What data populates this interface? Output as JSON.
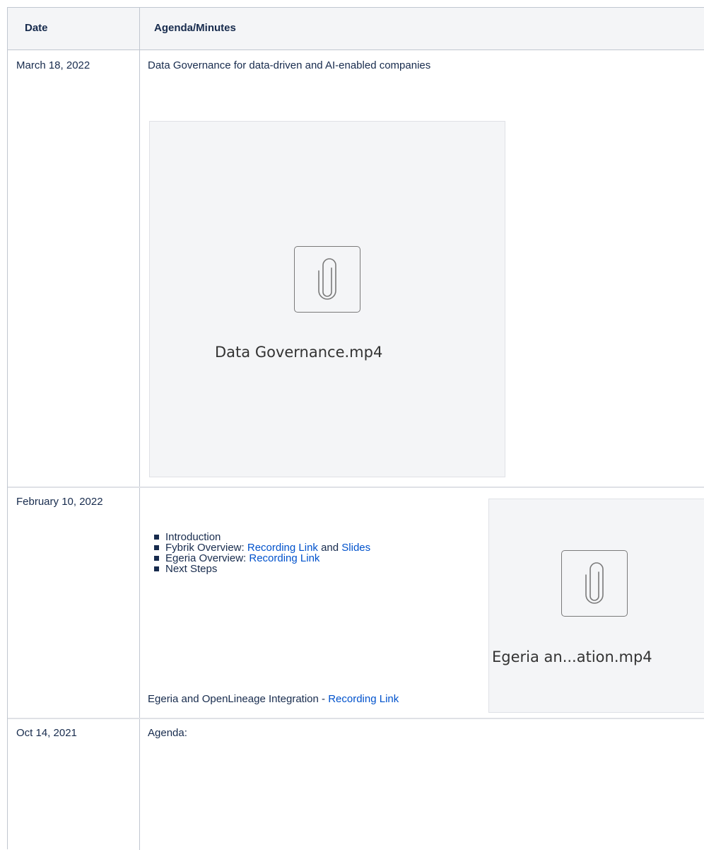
{
  "table": {
    "headers": {
      "date": "Date",
      "agenda": "Agenda/Minutes"
    },
    "rows": [
      {
        "date": "March 18, 2022",
        "title": "Data Governance for data-driven and AI-enabled companies",
        "attachment": {
          "filename": "Data Governance.mp4",
          "icon": "paperclip-icon"
        }
      },
      {
        "date": "February 10, 2022",
        "text": "Egeria and OpenLineage Integration - ",
        "link": "Recording Link",
        "attachment": {
          "filename": "Egeria an...ation.mp4",
          "icon": "paperclip-icon"
        }
      },
      {
        "date": "Oct 14, 2021",
        "agenda_label": "Agenda:",
        "items": [
          {
            "text": "Introduction"
          },
          {
            "prefix": "Fybrik Overview: ",
            "link1": "Recording Link",
            "middle": " and ",
            "link2": "Slides"
          },
          {
            "prefix": "Egeria Overview: ",
            "link1": "Recording Link"
          },
          {
            "text": "Next Steps"
          }
        ]
      }
    ]
  },
  "colors": {
    "link": "#0052cc",
    "text": "#172b4d",
    "border": "#c1c7d0",
    "header_bg": "#f4f5f7"
  }
}
